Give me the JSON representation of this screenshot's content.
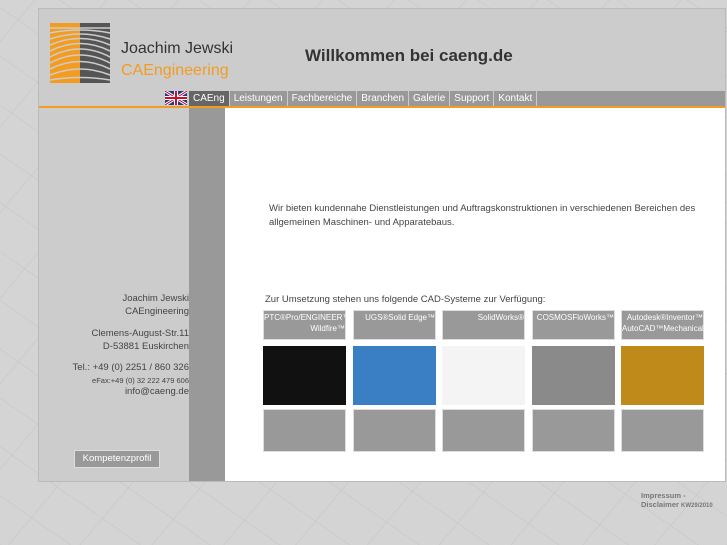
{
  "header": {
    "name": "Joachim Jewski",
    "company": "CAEngineering",
    "welcome": "Willkommen bei caeng.de"
  },
  "nav": {
    "lang_icon": "uk-flag-icon",
    "items": [
      "CAEng",
      "Leistungen",
      "Fachbereiche",
      "Branchen",
      "Galerie",
      "Support",
      "Kontakt"
    ],
    "active": "CAEng"
  },
  "sidebar": {
    "name": "Joachim Jewski",
    "company": "CAEngineering",
    "street": "Clemens-August-Str.11",
    "city": "D-53881 Euskirchen",
    "tel": "Tel.: +49 (0) 2251 / 860 326",
    "fax": "eFax:+49 (0) 32 222 479 606",
    "email": "info@caeng.de",
    "button": "Kompetenzprofil"
  },
  "main": {
    "intro": "Wir bieten kundennahe Dienstleistungen und Auftragskonstruktionen in verschiedenen Bereichen des allgemeinen Maschinen- und Apparatebaus.",
    "cad_heading": "Zur Umsetzung stehen uns folgende CAD-Systeme zur Verfügung:",
    "cad": [
      {
        "label": "PTC®Pro/ENGINEER™ Wildfire™",
        "color": "#111111"
      },
      {
        "label": "UGS®Solid Edge™",
        "color": "#3a7fc4"
      },
      {
        "label": "SolidWorks®",
        "color": "#f4f4f4"
      },
      {
        "label": "COSMOSFloWorks™",
        "color": "#8a8a8a"
      },
      {
        "label": "Autodesk®Inventor™ AutoCAD™Mechanical",
        "color": "#c08a1a"
      }
    ]
  },
  "footer": {
    "links": "Impressum - Disclaimer",
    "version": "KW29/2010"
  }
}
